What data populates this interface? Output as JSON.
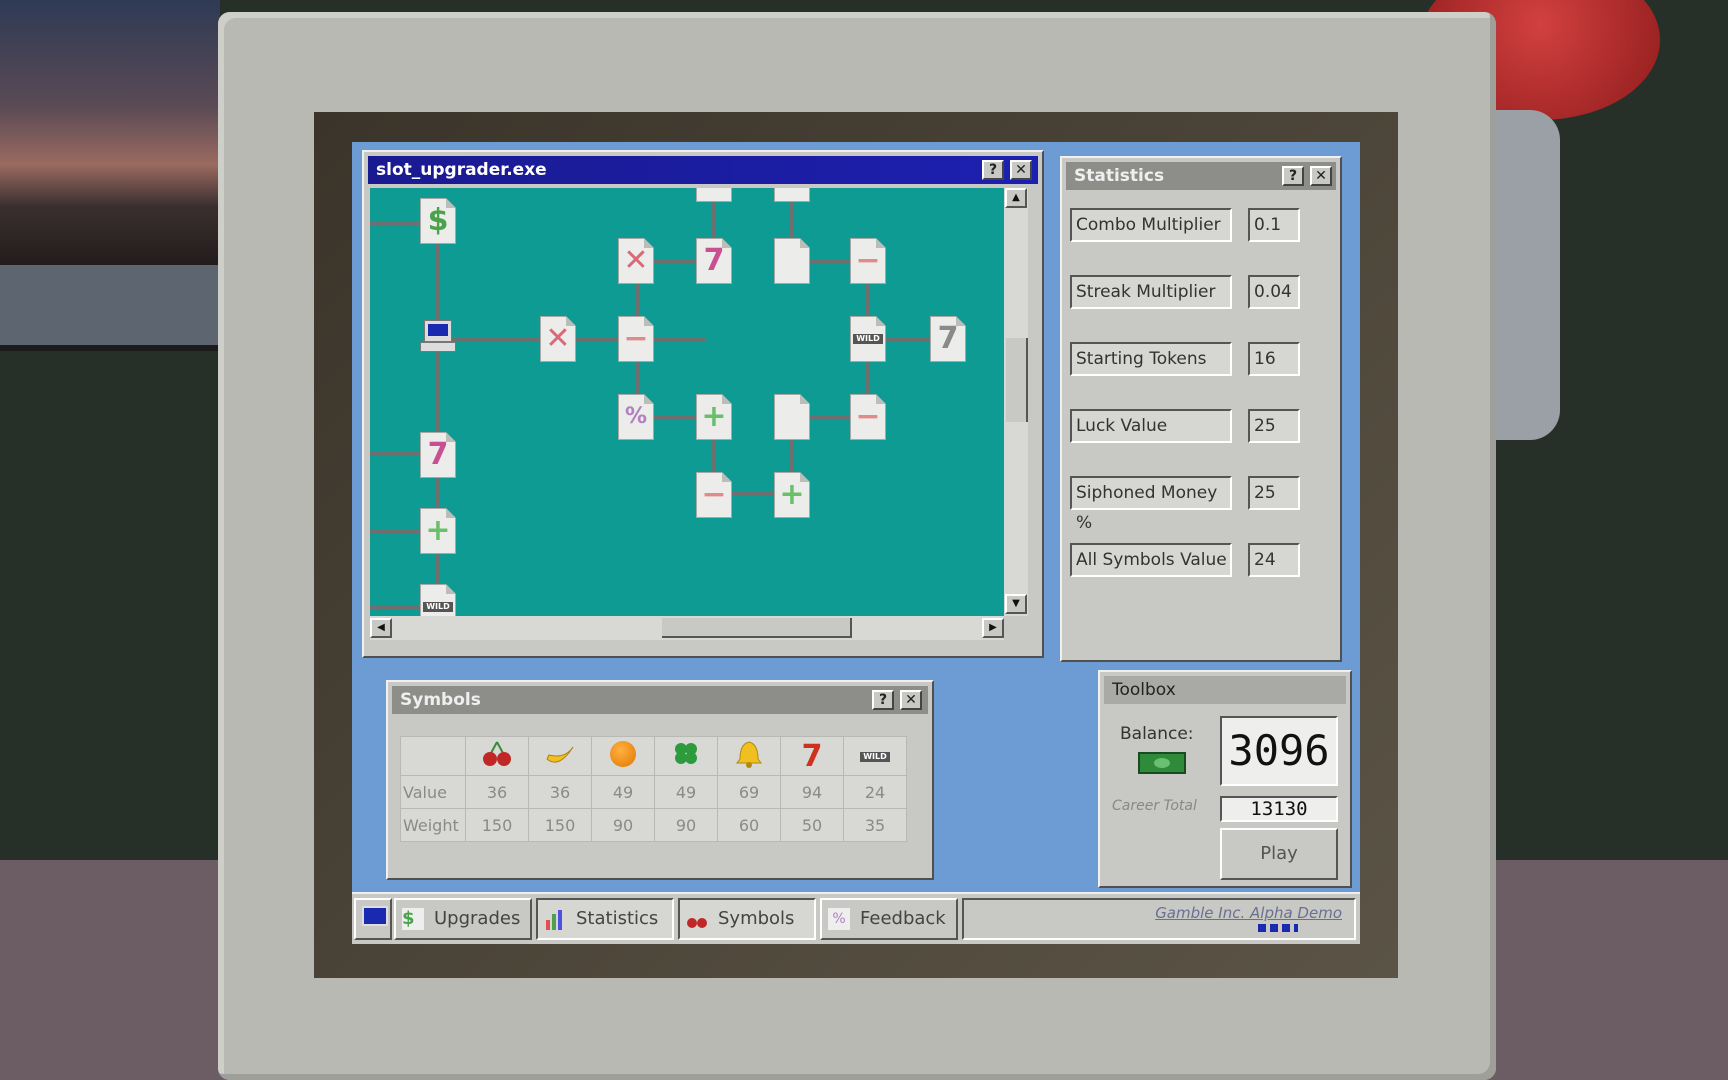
{
  "slot_window": {
    "title": "slot_upgrader.exe",
    "help_label": "?",
    "close_label": "✕"
  },
  "statistics_window": {
    "title": "Statistics",
    "help_label": "?",
    "close_label": "✕",
    "rows": [
      {
        "label": "Combo Multiplier",
        "value": "0.1"
      },
      {
        "label": "Streak Multiplier",
        "value": "0.04"
      },
      {
        "label": "Starting Tokens",
        "value": "16"
      },
      {
        "label": "Luck Value",
        "value": "25"
      },
      {
        "label": "Siphoned Money %",
        "value": "25"
      },
      {
        "label": "All Symbols Value",
        "value": "24"
      }
    ]
  },
  "symbols_window": {
    "title": "Symbols",
    "help_label": "?",
    "close_label": "✕",
    "row_labels": [
      "Value",
      "Weight"
    ],
    "symbols": [
      {
        "icon": "cherry-icon",
        "value": "36",
        "weight": "150"
      },
      {
        "icon": "banana-icon",
        "value": "36",
        "weight": "150"
      },
      {
        "icon": "orange-icon",
        "value": "49",
        "weight": "90"
      },
      {
        "icon": "clover-icon",
        "value": "49",
        "weight": "90"
      },
      {
        "icon": "bell-icon",
        "value": "69",
        "weight": "60"
      },
      {
        "icon": "seven-icon",
        "value": "94",
        "weight": "50"
      },
      {
        "icon": "wild-icon",
        "value": "24",
        "weight": "35"
      }
    ],
    "seven_glyph": "7",
    "wild_text": "WILD"
  },
  "toolbox": {
    "title": "Toolbox",
    "balance_label": "Balance:",
    "balance": "3096",
    "career_label": "Career Total",
    "career_total": "13130",
    "play_label": "Play"
  },
  "taskbar": {
    "items": [
      {
        "label": "Upgrades",
        "icon": "dollar-file-icon"
      },
      {
        "label": "Statistics",
        "icon": "bar-chart-icon"
      },
      {
        "label": "Symbols",
        "icon": "cherry-icon"
      },
      {
        "label": "Feedback",
        "icon": "feedback-file-icon"
      }
    ],
    "brand": "Gamble Inc. Alpha Demo"
  },
  "upgrade_tree": {
    "node_glyphs": {
      "x": "✕",
      "seven": "7",
      "plus": "+",
      "minus": "−",
      "dollar": "$",
      "percent": "%",
      "wild": "WILD"
    }
  },
  "colors": {
    "title_active": "#1a1a90",
    "canvas": "#0d9b94",
    "desktop": "#6d9bd3",
    "balance_cash": "#2f8a3a"
  }
}
